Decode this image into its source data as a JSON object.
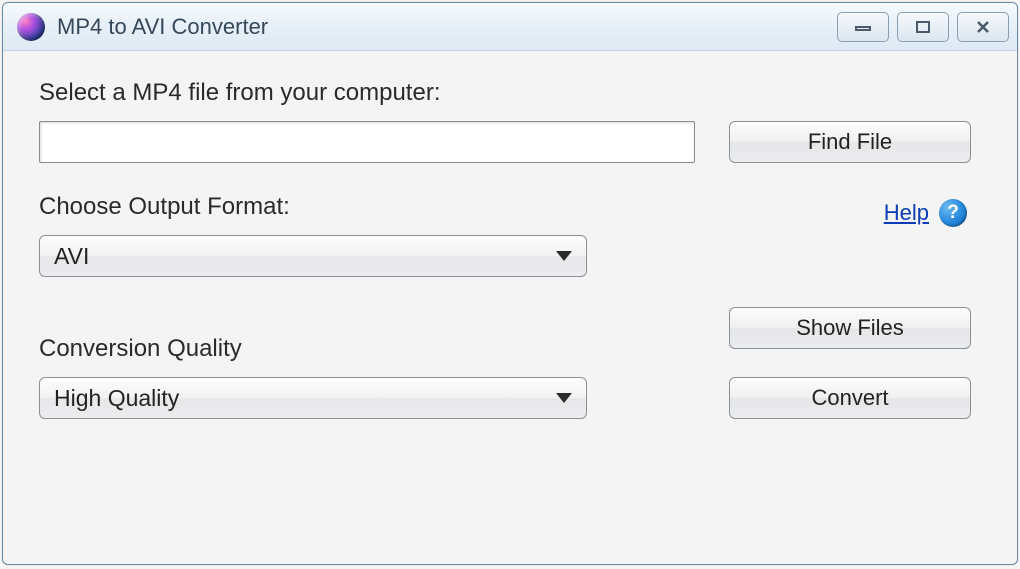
{
  "window": {
    "title": "MP4 to AVI Converter"
  },
  "labels": {
    "select_file": "Select a MP4 file from your computer:",
    "output_format": "Choose Output Format:",
    "conversion_quality": "Conversion Quality"
  },
  "inputs": {
    "file_path": ""
  },
  "selects": {
    "output_format_value": "AVI",
    "quality_value": "High Quality"
  },
  "buttons": {
    "find_file": "Find File",
    "show_files": "Show Files",
    "convert": "Convert"
  },
  "help": {
    "link_text": "Help",
    "icon_text": "?"
  }
}
